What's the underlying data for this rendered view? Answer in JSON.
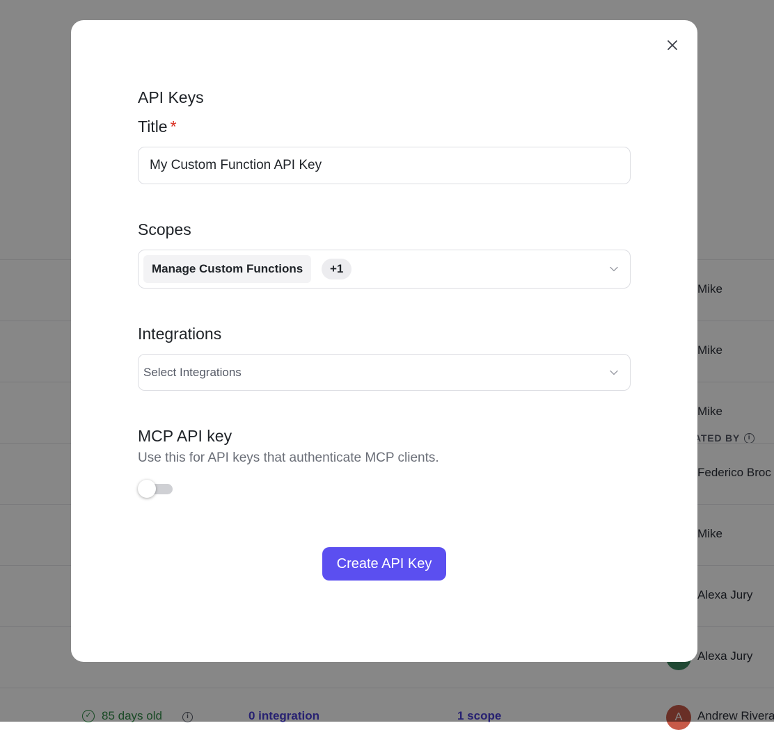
{
  "background": {
    "column_header": "ATED BY",
    "rows": [
      {
        "name": "Mike",
        "avatar_color": "#8b8b8b",
        "initial": ""
      },
      {
        "name": "Mike",
        "avatar_color": "#8b8b8b",
        "initial": ""
      },
      {
        "name": "Mike",
        "avatar_color": "#8b8b8b",
        "initial": ""
      },
      {
        "name": "Federico Broc",
        "avatar_color": "#8b8b8b",
        "initial": ""
      },
      {
        "name": "Mike",
        "avatar_color": "#8b8b8b",
        "initial": ""
      },
      {
        "name": "Alexa Jury",
        "avatar_color": "#8b8b8b",
        "initial": ""
      },
      {
        "name": "Alexa Jury",
        "avatar_color": "#3f8a63",
        "initial": ""
      }
    ],
    "last_row": {
      "age": "85 days old",
      "integrations": "0 integration",
      "scopes": "1 scope",
      "name": "Andrew Rivera",
      "initial": "A",
      "avatar_color": "#c75a48"
    }
  },
  "modal": {
    "heading": "API Keys",
    "title_label": "Title",
    "required_mark": "*",
    "title_value": "My Custom Function API Key",
    "scopes_label": "Scopes",
    "scopes_selected": "Manage Custom Functions",
    "scopes_more": "+1",
    "integrations_label": "Integrations",
    "integrations_placeholder": "Select Integrations",
    "mcp_label": "MCP API key",
    "mcp_description": "Use this for API keys that authenticate MCP clients.",
    "mcp_enabled": false,
    "create_button": "Create API Key"
  },
  "colors": {
    "accent": "#5b4ff0",
    "required": "#d92d20"
  }
}
